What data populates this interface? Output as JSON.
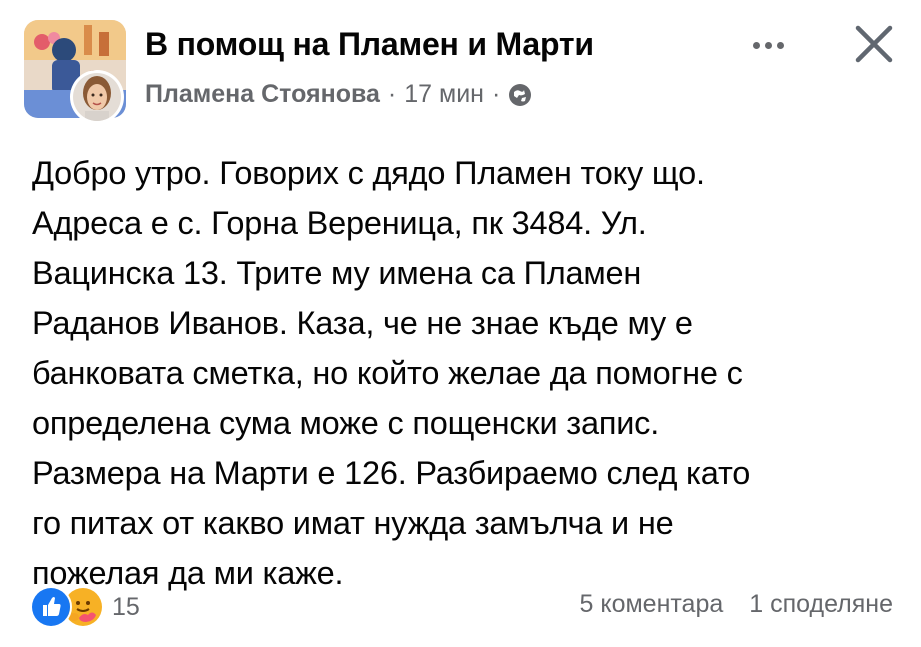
{
  "header": {
    "group_name": "В помощ на Пламен и Марти",
    "author": "Пламена Стоянова",
    "separator1": "·",
    "time": "17 мин",
    "separator2": "·",
    "privacy_icon": "globe-icon",
    "more_icon": "more-horizontal-icon",
    "close_icon": "close-icon"
  },
  "post": {
    "text": "Добро утро. Говорих с дядо Пламен току що.\nАдреса е с. Горна Вереница, пк 3484. Ул.\nВацинска 13. Трите му имена са Пламен\nРаданов Иванов. Каза, че не знае къде му е\nбанковата сметка, но който желае да помогне с\nопределена сума може с пощенски запис.\nРазмера на Марти е 126. Разбираемо след като\nго питах от какво имат нужда замълча и не\nпожелая да ми каже."
  },
  "footer": {
    "reaction_icons": [
      "like-icon",
      "care-icon"
    ],
    "reaction_count": "15",
    "comments": "5 коментара",
    "shares": "1 споделяне"
  },
  "colors": {
    "text": "#050505",
    "secondary": "#65676b",
    "like_blue": "#1877f2",
    "care_yellow": "#f7b125"
  }
}
